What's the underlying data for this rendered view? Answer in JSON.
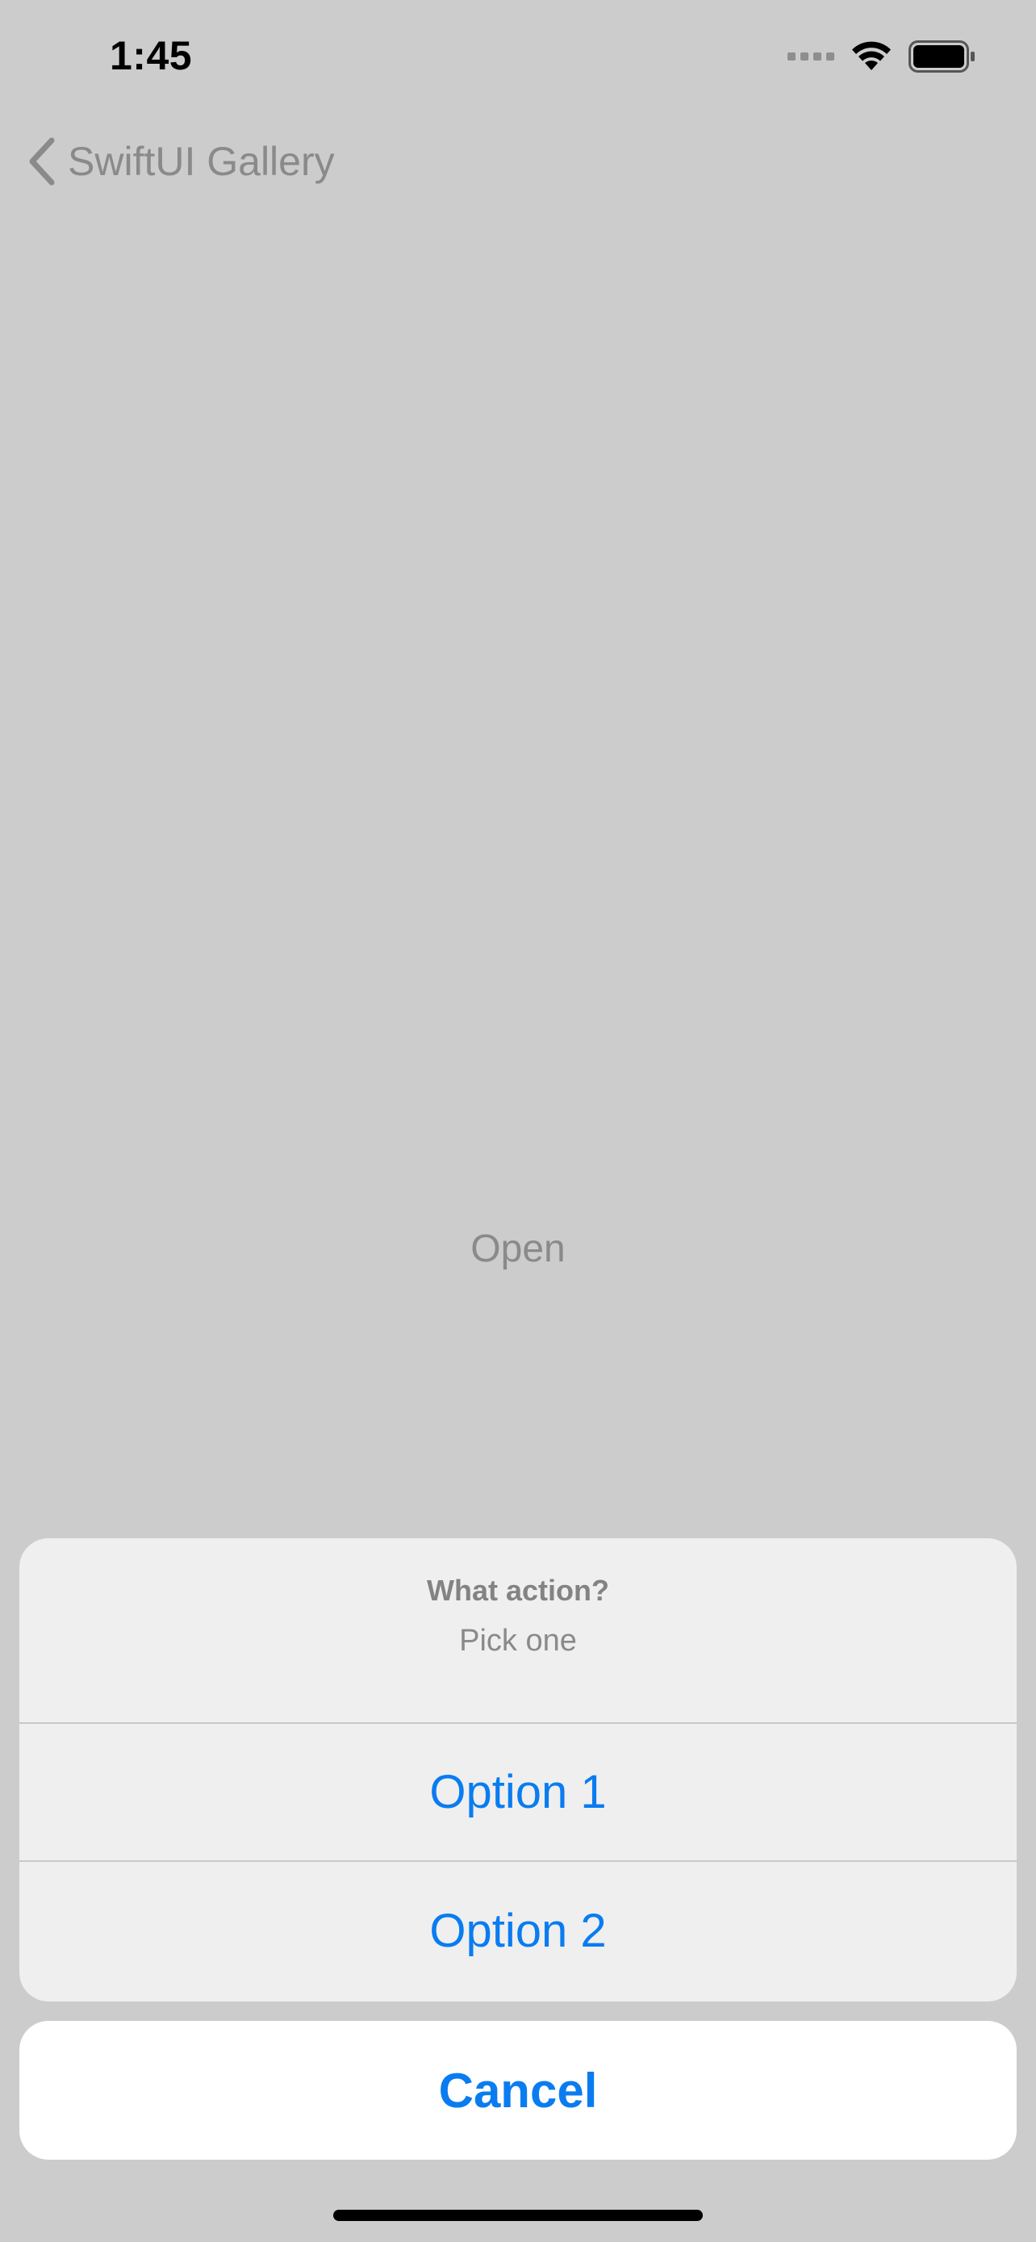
{
  "status_bar": {
    "time": "1:45",
    "icons": [
      "cellular-signal-icon",
      "wifi-icon",
      "battery-icon"
    ]
  },
  "nav": {
    "back_label": "SwiftUI Gallery",
    "back_icon": "chevron-left-icon"
  },
  "content": {
    "open_label": "Open"
  },
  "action_sheet": {
    "title": "What action?",
    "message": "Pick one",
    "options": [
      {
        "label": "Option 1"
      },
      {
        "label": "Option 2"
      }
    ],
    "cancel_label": "Cancel"
  },
  "colors": {
    "background_dim": "#cccccc",
    "accent": "#0a7cf0",
    "sheet_background": "#efefef",
    "cancel_background": "#ffffff"
  }
}
